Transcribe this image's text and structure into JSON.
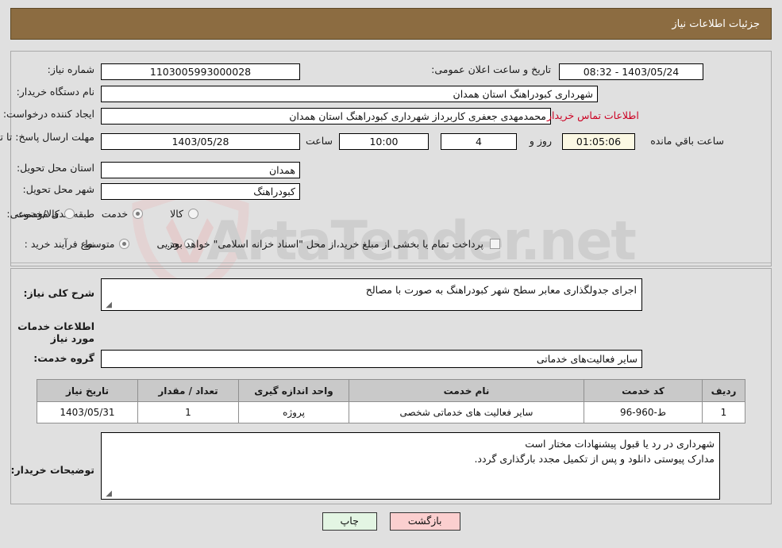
{
  "header": {
    "title": "جزئیات اطلاعات نیاز"
  },
  "fields": {
    "need_number": {
      "label": "شماره نیاز:",
      "value": "1103005993000028"
    },
    "announce_datetime": {
      "label": "تاریخ و ساعت اعلان عمومی:",
      "value": "1403/05/24 - 08:32"
    },
    "buyer_org": {
      "label": "نام دستگاه خریدار:",
      "value": "شهرداری کبودراهنگ استان همدان"
    },
    "request_creator": {
      "label": "ایجاد کننده درخواست:",
      "value": "محمدمهدی جعفری کاربرداز شهرداری کبودراهنگ استان همدان"
    },
    "buyer_contact_link": "اطلاعات تماس خریدار",
    "deadline": {
      "label": "مهلت ارسال پاسخ: تا تاریخ:",
      "date": "1403/05/28",
      "time_label": "ساعت",
      "time": "10:00",
      "days": "4",
      "days_suffix_label": "روز و",
      "countdown": "01:05:06",
      "countdown_suffix_label": "ساعت باقي مانده"
    },
    "delivery_province": {
      "label": "استان محل تحویل:",
      "value": "همدان"
    },
    "delivery_city": {
      "label": "شهر محل تحویل:",
      "value": "کبودراهنگ"
    },
    "category": {
      "label": "طبقه بندی موضوعی:",
      "options": [
        "کالا",
        "خدمت",
        "کالا/خدمت"
      ],
      "selected": "خدمت"
    },
    "purchase_process": {
      "label": "نوع فرآیند خرید :",
      "options": [
        "جزیی",
        "متوسط"
      ],
      "selected": "متوسط",
      "checkbox_label": "پرداخت تمام یا بخشی از مبلغ خرید،از محل \"اسناد خزانه اسلامی\" خواهد بود.",
      "checkbox_checked": false
    },
    "general_description": {
      "label": "شرح کلی نیاز:",
      "value": "اجرای جدولگذاری معابر سطح شهر کبودراهنگ به صورت با مصالح"
    },
    "services_section_title": "اطلاعات خدمات مورد نیاز",
    "service_group": {
      "label": "گروه خدمت:",
      "value": "سایر فعالیت‌های خدماتی"
    },
    "buyer_notes": {
      "label": "توضیحات خریدار:",
      "line1": "شهرداری در رد یا قبول پیشنهادات مختار است",
      "line2": "مدارک پیوستی دانلود و پس از تکمیل مجدد بارگذاری گردد."
    }
  },
  "table": {
    "headers": [
      "ردیف",
      "کد خدمت",
      "نام خدمت",
      "واحد اندازه گیری",
      "تعداد / مقدار",
      "تاریخ نیاز"
    ],
    "rows": [
      {
        "row_no": "1",
        "service_code": "ط-960-96",
        "service_name": "سایر فعالیت های خدماتی شخصی",
        "unit": "پروژه",
        "quantity": "1",
        "need_date": "1403/05/31"
      }
    ]
  },
  "footer": {
    "back_button": "بازگشت",
    "print_button": "چاپ"
  },
  "watermark": {
    "text": "ArtaTender.net"
  },
  "colors": {
    "header_bg": "#8c6c41",
    "link": "#cc0022",
    "back_btn": "#fbcfcf",
    "print_btn": "#e3f5e3",
    "table_header": "#c9c9c9",
    "page_bg": "#e0e0e0"
  }
}
